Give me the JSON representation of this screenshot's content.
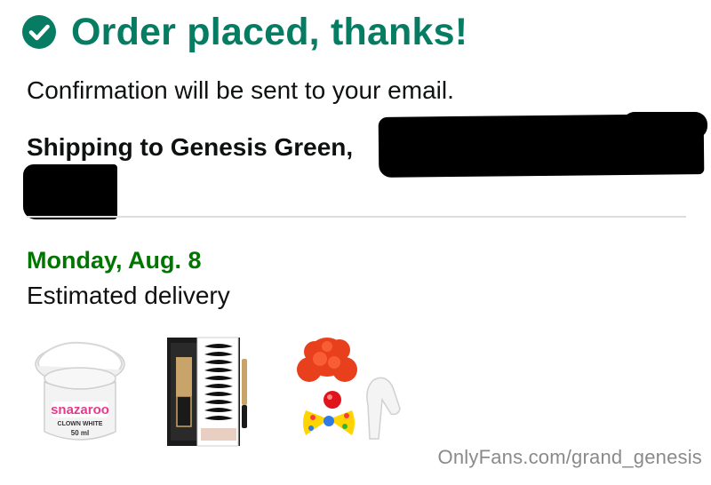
{
  "header": {
    "title": "Order placed, thanks!",
    "icon": "checkmark-circle-icon",
    "accent_color": "#067d62"
  },
  "confirmation": {
    "message": "Confirmation will be sent to your email."
  },
  "shipping": {
    "label": "Shipping to Genesis Green,"
  },
  "delivery": {
    "date": "Monday, Aug. 8",
    "label": "Estimated delivery",
    "date_color": "#007600"
  },
  "products": [
    {
      "brand": "snazaroo",
      "name": "CLOWN WHITE",
      "size": "50 ml"
    },
    {
      "name": "magnetic-eyelashes-kit"
    },
    {
      "name": "clown-costume-set"
    }
  ],
  "watermark": {
    "text": "OnlyFans.com/grand_genesis"
  }
}
